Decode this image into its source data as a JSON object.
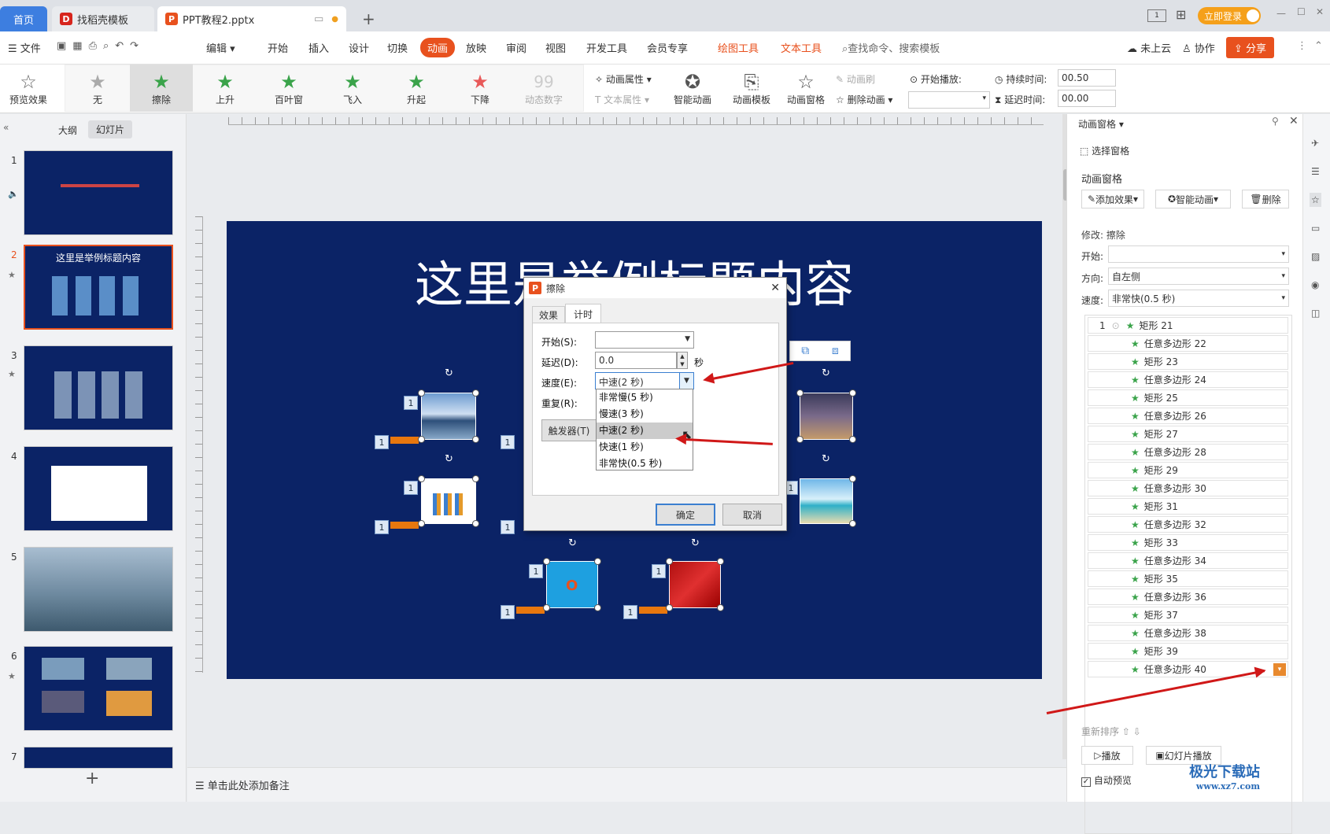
{
  "tabs": {
    "home": "首页",
    "template": "找稻壳模板",
    "file": "PPT教程2.pptx",
    "new": "+",
    "login": "立即登录"
  },
  "menubar": {
    "file": "文件",
    "edit": "编辑",
    "items": [
      "开始",
      "插入",
      "设计",
      "切换",
      "动画",
      "放映",
      "审阅",
      "视图",
      "开发工具",
      "会员专享"
    ],
    "drawing_tools": "绘图工具",
    "text_tools": "文本工具",
    "search": "查找命令、搜索模板",
    "cloud": "未上云",
    "collab": "协作",
    "share": "分享"
  },
  "ribbon": {
    "preview": "预览效果",
    "effects": [
      "无",
      "擦除",
      "上升",
      "百叶窗",
      "飞入",
      "升起",
      "下降",
      "动态数字"
    ],
    "anim_props": "动画属性",
    "text_props": "文本属性",
    "smart_anim": "智能动画",
    "anim_template": "动画模板",
    "anim_pane": "动画窗格",
    "anim_brush": "动画刷",
    "delete_anim": "删除动画",
    "start_play": "开始播放:",
    "duration_label": "持续时间:",
    "duration_value": "00.50",
    "delay_label": "延迟时间:",
    "delay_value": "00.00"
  },
  "left_panel": {
    "outline_tab": "大纲",
    "slides_tab": "幻灯片",
    "slide_numbers": [
      "1",
      "2",
      "3",
      "4",
      "5",
      "6",
      "7"
    ],
    "slide2_title": "这里是举例标题内容"
  },
  "slide": {
    "title": "这里是举例标题内容",
    "badge": "1"
  },
  "dialog": {
    "title": "擦除",
    "tab_effect": "效果",
    "tab_timing": "计时",
    "start_label": "开始(S):",
    "delay_label": "延迟(D):",
    "delay_value": "0.0",
    "delay_unit": "秒",
    "speed_label": "速度(E):",
    "speed_value": "中速(2 秒)",
    "repeat_label": "重复(R):",
    "trigger_button": "触发器(T)",
    "ok": "确定",
    "cancel": "取消",
    "speed_options": [
      "非常慢(5 秒)",
      "慢速(3 秒)",
      "中速(2 秒)",
      "快速(1 秒)",
      "非常快(0.5 秒)"
    ]
  },
  "right_panel": {
    "header": "动画窗格",
    "select_pane": "选择窗格",
    "section_title": "动画窗格",
    "add_effect": "添加效果",
    "smart_anim": "智能动画",
    "delete": "删除",
    "modify": "修改: 擦除",
    "start_label": "开始:",
    "direction_label": "方向:",
    "direction_value": "自左侧",
    "speed_label": "速度:",
    "speed_value": "非常快(0.5 秒)",
    "first_index": "1",
    "items": [
      "矩形 21",
      "任意多边形 22",
      "矩形 23",
      "任意多边形 24",
      "矩形 25",
      "任意多边形 26",
      "矩形 27",
      "任意多边形 28",
      "矩形 29",
      "任意多边形 30",
      "矩形 31",
      "任意多边形 32",
      "矩形 33",
      "任意多边形 34",
      "矩形 35",
      "任意多边形 36",
      "矩形 37",
      "任意多边形 38",
      "矩形 39",
      "任意多边形 40"
    ],
    "reorder": "重新排序",
    "play": "播放",
    "slideshow": "幻灯片播放",
    "auto_preview": "自动预览"
  },
  "status": {
    "notes": "单击此处添加备注"
  },
  "watermark": {
    "name": "极光下载站",
    "url": "www.xz7.com"
  },
  "colors": {
    "accent": "#e8511e",
    "slide_bg": "#0b2366",
    "login": "#f5a01a",
    "active_tab": "#e8511e"
  }
}
